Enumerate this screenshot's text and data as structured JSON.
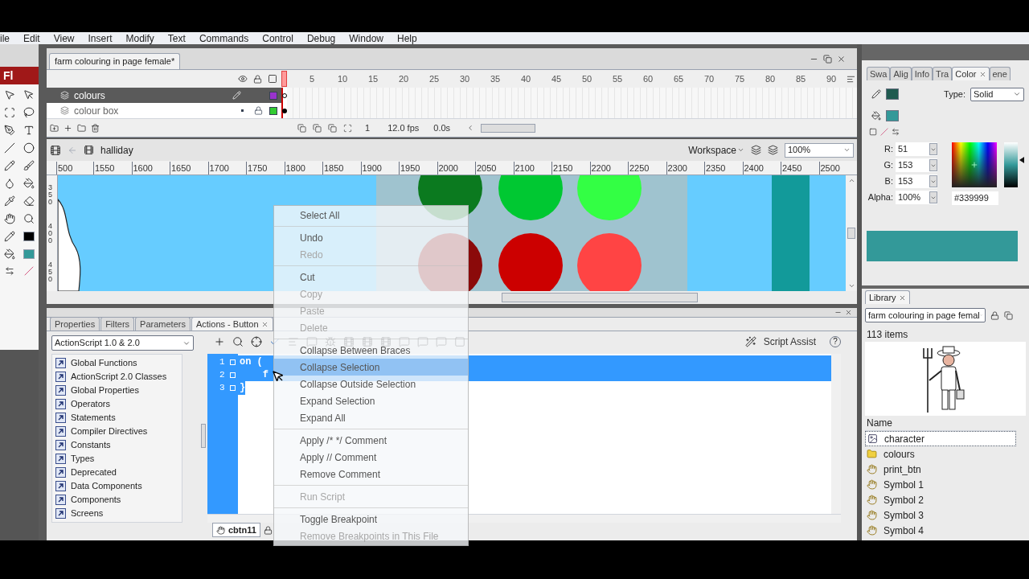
{
  "menu_bar": [
    "ile",
    "Edit",
    "View",
    "Insert",
    "Modify",
    "Text",
    "Commands",
    "Control",
    "Debug",
    "Window",
    "Help"
  ],
  "app_logo": "Fl",
  "document_tab": {
    "title": "farm colouring in page female*",
    "selected": true
  },
  "timeline": {
    "frame_numbers": [
      "5",
      "10",
      "15",
      "20",
      "25",
      "30",
      "35",
      "40",
      "45",
      "50",
      "55",
      "60",
      "65",
      "70",
      "75",
      "80",
      "85",
      "90"
    ],
    "layers": [
      {
        "name": "colours",
        "selected": true,
        "locked": false,
        "color": "#9933cc"
      },
      {
        "name": "colour box",
        "selected": false,
        "locked": true,
        "color": "#33cc33"
      }
    ],
    "current_frame": "1",
    "frame_rate": "12.0 fps",
    "elapsed": "0.0s"
  },
  "edit_bar": {
    "scene": "halliday",
    "workspace": "Workspace",
    "zoom": "100%"
  },
  "ruler": {
    "horizontal": [
      "500",
      "1550",
      "1600",
      "1650",
      "1700",
      "1750",
      "1800",
      "1850",
      "1900",
      "1950",
      "2000",
      "2050",
      "2100",
      "2150",
      "2200",
      "2250",
      "2300",
      "2350",
      "2400",
      "2450",
      "2500"
    ],
    "vertical": [
      "350",
      "400",
      "450"
    ]
  },
  "stage": {
    "swatches": [
      {
        "color": "#0b7a1f"
      },
      {
        "color": "#00c832"
      },
      {
        "color": "#33ff44"
      },
      {
        "color": "#8b0a0a"
      },
      {
        "color": "#cc0000"
      },
      {
        "color": "#ff4444"
      }
    ]
  },
  "panel_tabs": [
    {
      "label": "Properties",
      "selected": false,
      "closable": false
    },
    {
      "label": "Filters",
      "selected": false,
      "closable": false
    },
    {
      "label": "Parameters",
      "selected": false,
      "closable": false
    },
    {
      "label": "Actions - Button",
      "selected": true,
      "closable": true
    }
  ],
  "actions": {
    "language": "ActionScript 1.0 & 2.0",
    "toolbox": [
      "Global Functions",
      "ActionScript 2.0 Classes",
      "Global Properties",
      "Operators",
      "Statements",
      "Compiler Directives",
      "Constants",
      "Types",
      "Deprecated",
      "Data Components",
      "Components",
      "Screens"
    ],
    "script_assist": "Script Assist",
    "help": "?",
    "code": [
      {
        "number": "1",
        "text": "on ("
      },
      {
        "number": "2",
        "text": "    f"
      },
      {
        "number": "3",
        "text": "}"
      }
    ],
    "script_tab": "cbtn11"
  },
  "context_menu": {
    "groups": [
      [
        {
          "label": "Select All",
          "disabled": false,
          "selected": false
        }
      ],
      [
        {
          "label": "Undo",
          "disabled": false,
          "selected": false
        },
        {
          "label": "Redo",
          "disabled": true,
          "selected": false
        }
      ],
      [
        {
          "label": "Cut",
          "disabled": false,
          "selected": false
        },
        {
          "label": "Copy",
          "disabled": true,
          "selected": false
        },
        {
          "label": "Paste",
          "disabled": true,
          "selected": false
        },
        {
          "label": "Delete",
          "disabled": true,
          "selected": false
        }
      ],
      [
        {
          "label": "Collapse Between Braces",
          "disabled": false,
          "selected": false
        },
        {
          "label": "Collapse Selection",
          "disabled": false,
          "selected": true
        },
        {
          "label": "Collapse Outside Selection",
          "disabled": false,
          "selected": false
        },
        {
          "label": "Expand Selection",
          "disabled": false,
          "selected": false
        },
        {
          "label": "Expand All",
          "disabled": false,
          "selected": false
        }
      ],
      [
        {
          "label": "Apply /* */ Comment",
          "disabled": false,
          "selected": false
        },
        {
          "label": "Apply // Comment",
          "disabled": false,
          "selected": false
        },
        {
          "label": "Remove Comment",
          "disabled": false,
          "selected": false
        }
      ],
      [
        {
          "label": "Run Script",
          "disabled": true,
          "selected": false
        }
      ],
      [
        {
          "label": "Toggle Breakpoint",
          "disabled": false,
          "selected": false
        },
        {
          "label": "Remove Breakpoints in This File",
          "disabled": true,
          "selected": false
        }
      ]
    ]
  },
  "color_panel": {
    "tabs": [
      {
        "label": "Swa",
        "selected": false,
        "closable": false
      },
      {
        "label": "Alig",
        "selected": false,
        "closable": false
      },
      {
        "label": "Info",
        "selected": false,
        "closable": false
      },
      {
        "label": "Tra",
        "selected": false,
        "closable": false
      },
      {
        "label": "Color",
        "selected": true,
        "closable": true
      },
      {
        "label": "ene",
        "selected": false,
        "closable": false
      }
    ],
    "type_label": "Type:",
    "type": "Solid",
    "channels": [
      {
        "label": "R:",
        "value": "51"
      },
      {
        "label": "G:",
        "value": "153"
      },
      {
        "label": "B:",
        "value": "153"
      },
      {
        "label": "Alpha:",
        "value": "100%"
      }
    ],
    "hex": "#339999"
  },
  "library": {
    "tab": "Library",
    "document": "farm colouring in page femal",
    "count": "113 items",
    "column": "Name",
    "items": [
      {
        "name": "character",
        "kind": "bitmap",
        "selected": true
      },
      {
        "name": "colours",
        "kind": "folder",
        "selected": false
      },
      {
        "name": "print_btn",
        "kind": "button",
        "selected": false
      },
      {
        "name": "Symbol 1",
        "kind": "button",
        "selected": false
      },
      {
        "name": "Symbol 2",
        "kind": "button",
        "selected": false
      },
      {
        "name": "Symbol 3",
        "kind": "button",
        "selected": false
      },
      {
        "name": "Symbol 4",
        "kind": "button",
        "selected": false
      }
    ]
  }
}
